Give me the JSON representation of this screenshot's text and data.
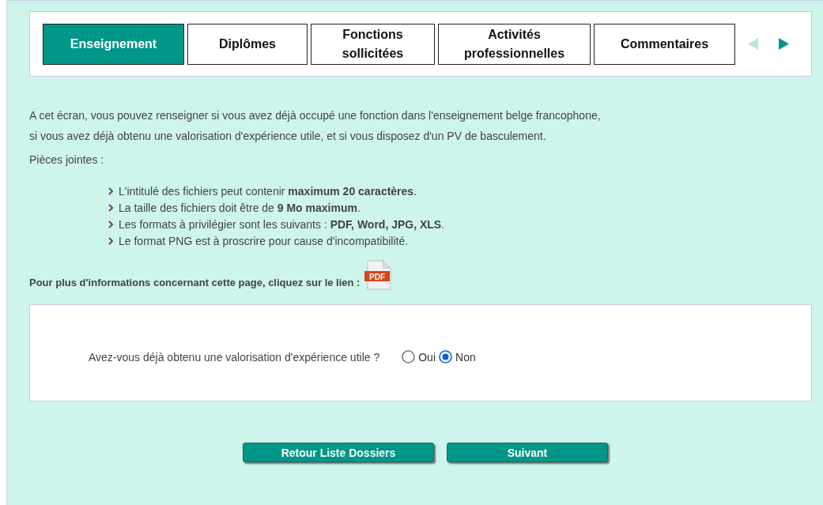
{
  "tabs": [
    {
      "label": "Enseignement",
      "selected": true
    },
    {
      "label": "Diplômes",
      "selected": false
    },
    {
      "label": "Fonctions sollicitées",
      "selected": false
    },
    {
      "label": "Activités professionnelles",
      "selected": false
    },
    {
      "label": "Commentaires",
      "selected": false
    }
  ],
  "tab_nav": {
    "previous_disabled": true,
    "next_disabled": false
  },
  "intro": [
    "A cet écran, vous pouvez renseigner si vous avez déjà occupé une fonction dans l'enseignement belge francophone,",
    "si vous avez déjà obtenu une valorisation d'expérience utile, et si vous disposez d'un PV de basculement."
  ],
  "attachments_title": "Pièces jointes :",
  "rules": [
    "L'intitulé des fichiers peut contenir **maximum 20 caractères**.",
    "La taille des fichiers doit être de **9 Mo maximum**.",
    "Les formats à privilégier sont les suivants : **PDF, Word, JPG, XLS**.",
    "Le format PNG est à proscrire pour cause d'incompatibilité."
  ],
  "info_link": {
    "text": "Pour plus d'informations concernant cette page, cliquez sur le lien :",
    "file_label": "PDF"
  },
  "question": {
    "label": "Avez-vous déjà obtenu une valorisation d'expérience utile ?",
    "options": [
      {
        "label": "Oui",
        "selected": false
      },
      {
        "label": "Non",
        "selected": true
      }
    ]
  },
  "buttons": [
    "Retour Liste Dossiers",
    "Suivant"
  ]
}
